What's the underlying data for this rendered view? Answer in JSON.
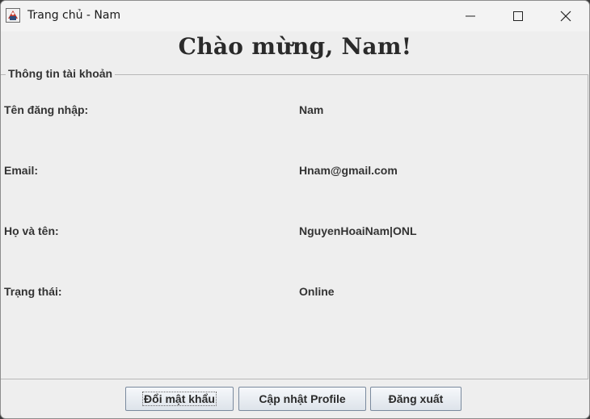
{
  "window": {
    "title": "Trang chủ - Nam"
  },
  "icons": {
    "app": "java-app-icon",
    "minimize": "minimize-icon",
    "maximize": "maximize-icon",
    "close": "close-icon"
  },
  "heading": "Chào mừng, Nam!",
  "account_panel": {
    "legend": "Thông tin tài khoản",
    "rows": [
      {
        "label": "Tên đăng nhập:",
        "value": "Nam"
      },
      {
        "label": "Email:",
        "value": "Hnam@gmail.com"
      },
      {
        "label": "Họ và tên:",
        "value": "NguyenHoaiNam|ONL"
      },
      {
        "label": "Trạng thái:",
        "value": "Online"
      }
    ]
  },
  "buttons": {
    "change_password": "Đổi mật khẩu",
    "update_profile": "Cập nhật Profile",
    "logout": "Đăng xuất"
  }
}
